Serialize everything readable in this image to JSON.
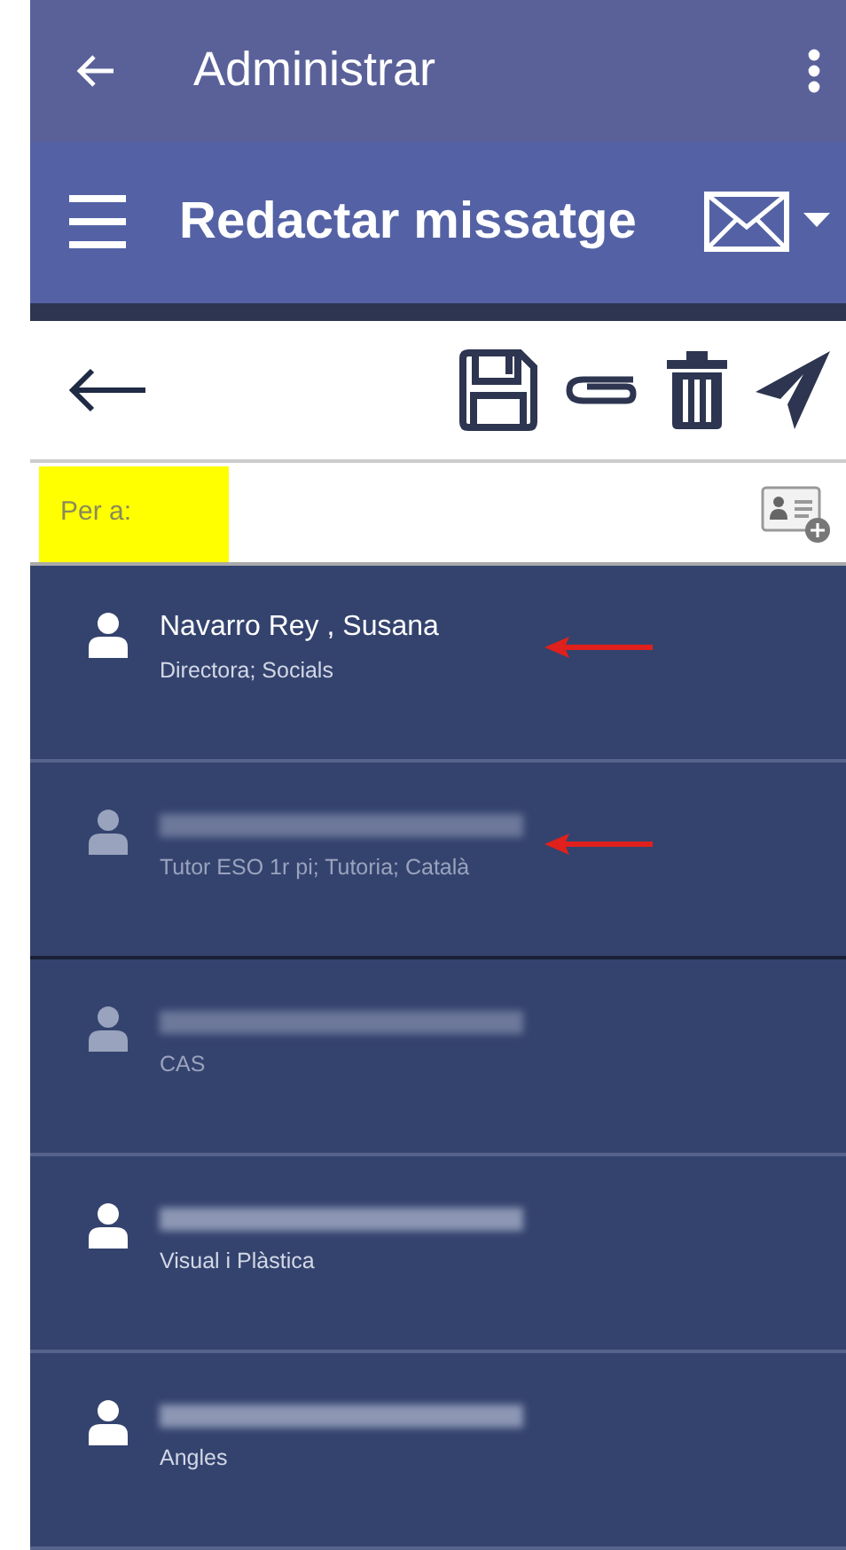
{
  "app_bar": {
    "title": "Administrar"
  },
  "header": {
    "title": "Redactar missatge"
  },
  "recipient_field": {
    "placeholder": "Per a:",
    "highlighted": true
  },
  "contacts": [
    {
      "name": "Navarro Rey , Susana",
      "subtitle": "Directora; Socials",
      "disabled": false,
      "marked": true
    },
    {
      "subtitle": "Tutor ESO 1r pi; Tutoria; Català",
      "disabled": true,
      "marked": true
    },
    {
      "subtitle": "CAS",
      "disabled": true,
      "marked": false
    },
    {
      "subtitle": "Visual i Plàstica",
      "disabled": false,
      "marked": false
    },
    {
      "subtitle": "Angles",
      "disabled": false,
      "marked": false
    }
  ]
}
